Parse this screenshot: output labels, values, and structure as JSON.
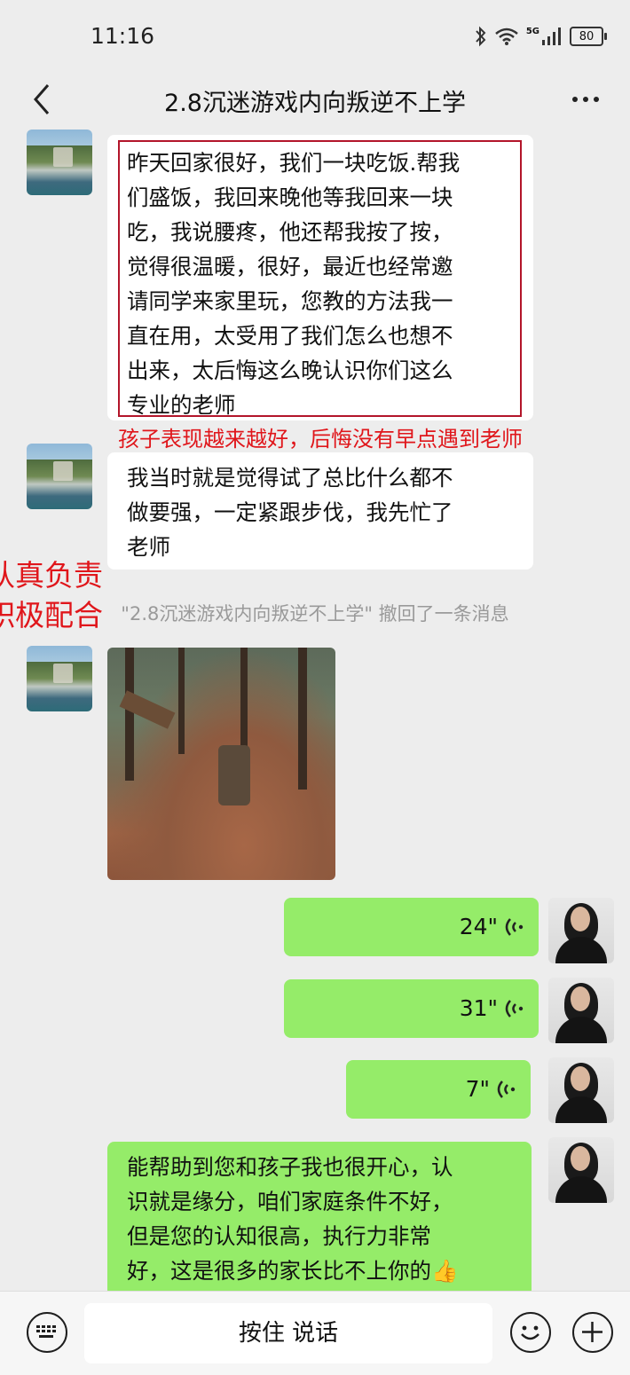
{
  "status_bar": {
    "time": "11:16",
    "network": "5G",
    "battery": "80"
  },
  "header": {
    "title": "2.8沉迷游戏内向叛逆不上学"
  },
  "messages": {
    "m1_lines": [
      "昨天回家很好，我们一块吃饭.帮我",
      "们盛饭，我回来晚他等我回来一块",
      "吃，我说腰疼，他还帮我按了按，",
      "觉得很温暖，很好，最近也经常邀",
      "请同学来家里玩，您教的方法我一",
      "直在用，太受用了我们怎么也想不",
      "出来，太后悔这么晚认识你们这么",
      "专业的老师"
    ],
    "m2_lines": [
      "我当时就是觉得试了总比什么都不",
      "做要强，一定紧跟步伐，我先忙了",
      "老师"
    ],
    "recall_notice": "\"2.8沉迷游戏内向叛逆不上学\" 撤回了一条消息",
    "voice1": "24\"",
    "voice2": "31\"",
    "voice3": "7\"",
    "m_last_lines": [
      "能帮助到您和孩子我也很开心，认",
      "识就是缘分，咱们家庭条件不好，",
      "但是您的认知很高，执行力非常",
      "好，这是很多的家长比不上你的👍"
    ]
  },
  "annotations": {
    "under_first": "孩子表现越来越好，后悔没有早点遇到老师",
    "left_line1": "认真负责",
    "left_line2": "积极配合"
  },
  "input_bar": {
    "talk_label": "按住 说话"
  },
  "colors": {
    "annotation_red": "#e0161b",
    "outgoing_bubble": "#95ec69",
    "incoming_bubble": "#ffffff",
    "background": "#ededed"
  }
}
